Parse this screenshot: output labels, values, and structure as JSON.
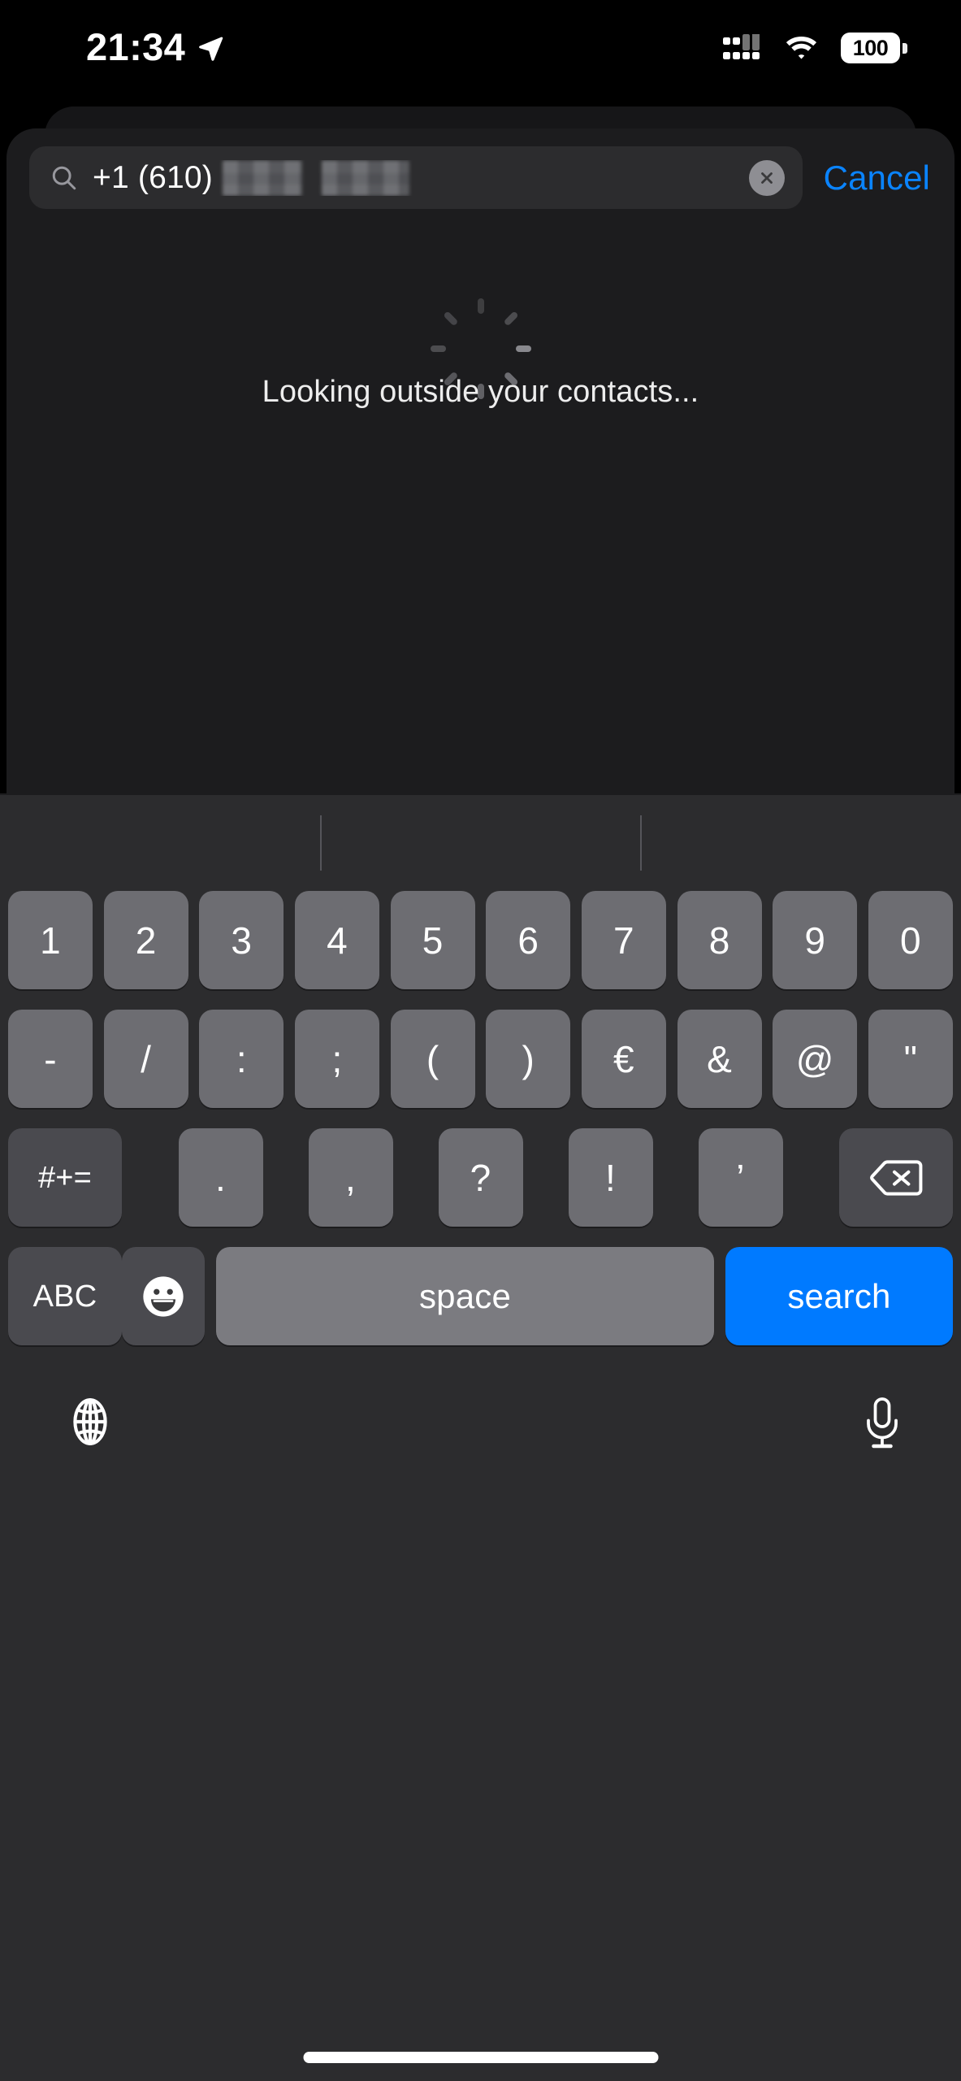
{
  "status_bar": {
    "time": "21:34",
    "location_icon": "location-arrow-icon",
    "cellular_icon": "cellular-signal-icon",
    "wifi_icon": "wifi-icon",
    "battery_level": "100",
    "battery_icon": "battery-icon"
  },
  "search": {
    "icon": "search-icon",
    "value": "+1 (610)",
    "redacted_note": "redacted-phone-digits",
    "clear_icon": "clear-circle-icon",
    "cancel_label": "Cancel"
  },
  "content": {
    "spinner": "activity-spinner-icon",
    "status_text": "Looking outside your contacts..."
  },
  "keyboard": {
    "row1": [
      "1",
      "2",
      "3",
      "4",
      "5",
      "6",
      "7",
      "8",
      "9",
      "0"
    ],
    "row2": [
      "-",
      "/",
      ":",
      ";",
      "(",
      ")",
      "€",
      "&",
      "@",
      "\""
    ],
    "row3_modifier": "#+=",
    "row3_symbols": [
      ".",
      ",",
      "?",
      "!",
      "’"
    ],
    "row3_backspace_icon": "backspace-icon",
    "row4": {
      "abc_label": "ABC",
      "emoji_icon": "emoji-smiley-icon",
      "space_label": "space",
      "return_label": "search"
    },
    "globe_icon": "globe-icon",
    "mic_icon": "microphone-icon"
  },
  "colors": {
    "accent_blue": "#007AFF",
    "cancel_blue": "#0A84FF",
    "sheet_bg": "#1C1C1E",
    "keyboard_bg": "#2C2C2E",
    "key_bg": "#6D6D72",
    "key_dark_bg": "#4A4A4F",
    "search_field_bg": "#2C2C2E"
  }
}
